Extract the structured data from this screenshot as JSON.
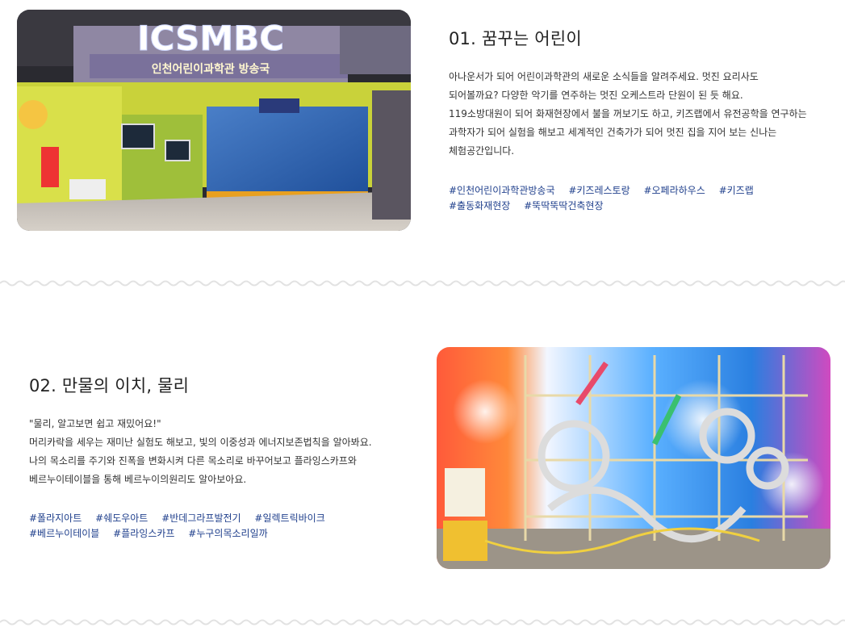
{
  "sections": [
    {
      "title": "01. 꿈꾸는 어린이",
      "photo": {
        "sign_text": "ICSMBC",
        "banner_text": "인천어린이과학관 방송국"
      },
      "desc_lines": [
        "아나운서가 되어 어린이과학관의 새로운 소식들을 알려주세요. 멋진 요리사도",
        "되어볼까요? 다양한 악기를 연주하는 멋진 오케스트라 단원이 된 듯 해요.",
        "119소방대원이 되어 화재현장에서 불을 꺼보기도 하고, 키즈랩에서 유전공학을 연구하는",
        "과학자가 되어 실험을 해보고 세계적인 건축가가 되어 멋진 집을 지어 보는 신나는",
        "체험공간입니다."
      ],
      "tags_row1": [
        "#인천어린이과학관방송국",
        "#키즈레스토랑",
        "#오페라하우스",
        "#키즈랩"
      ],
      "tags_row2": [
        "#출동화재현장",
        "#뚝딱뚝딱건축현장"
      ]
    },
    {
      "title": "02. 만물의 이치, 물리",
      "desc_lines": [
        "\"물리, 알고보면 쉽고 재밌어요!\"",
        "머리카락을 세우는 재미난 실험도 해보고, 빛의 이중성과 에너지보존법칙을 알아봐요.",
        "나의 목소리를 주기와 진폭을 변화시켜 다른 목소리로 바꾸어보고 플라잉스카프와",
        "베르누이테이블을 통해 베르누이의원리도 알아보아요."
      ],
      "tags_row1": [
        "#폴라지아트",
        "#쉐도우아트",
        "#반데그라프발전기",
        "#일렉트릭바이크"
      ],
      "tags_row2": [
        "#베르누이테이블",
        "#플라잉스카프",
        "#누구의목소리일까"
      ]
    }
  ],
  "colors": {
    "tag": "#1f3f8c",
    "wave": "#e2e2e2"
  }
}
